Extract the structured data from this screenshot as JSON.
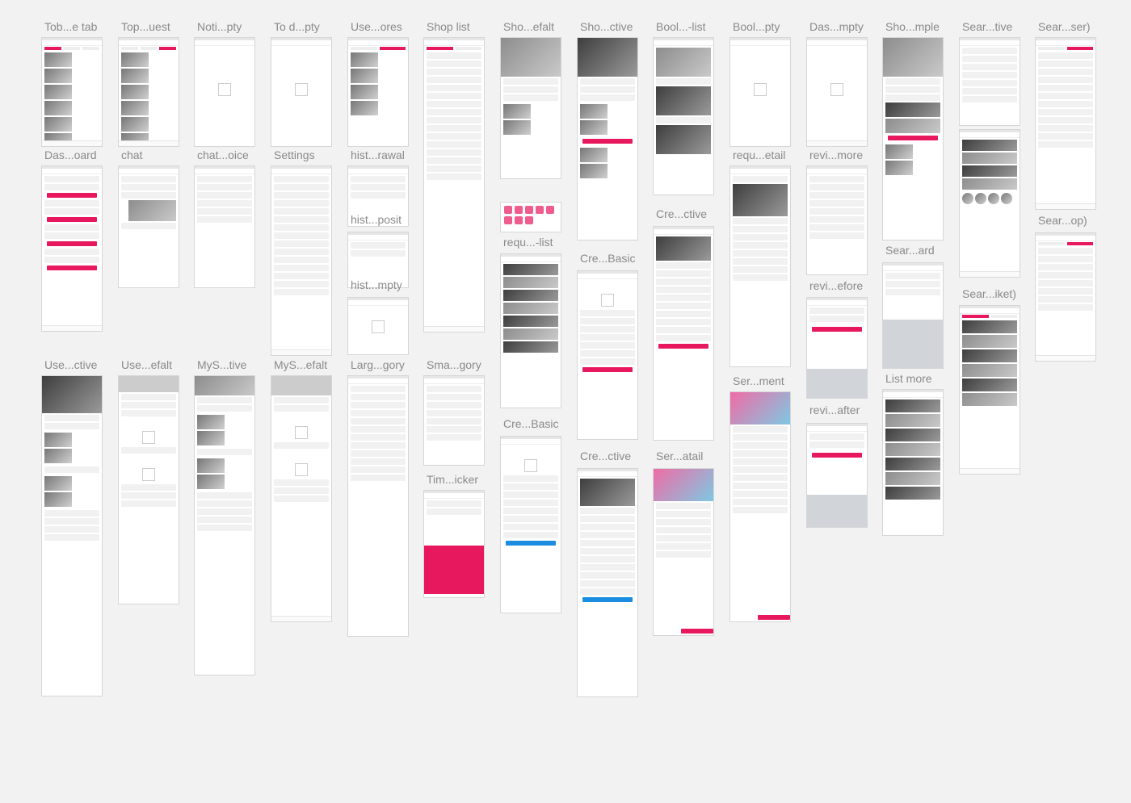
{
  "colors": {
    "background": "#f2f2f2",
    "accent": "#e8185e",
    "blue": "#1a8de0",
    "label": "#8a8a8a"
  },
  "boards": {
    "c1": [
      "Tob...e tab",
      "Das...oard",
      "Use...ctive"
    ],
    "c2": [
      "Top...uest",
      "chat",
      "Use...efalt"
    ],
    "c3": [
      "Noti...pty",
      "chat...oice",
      "MyS...tive"
    ],
    "c4": [
      "To d...pty",
      "Settings",
      "MyS...efalt"
    ],
    "c5": [
      "Use...ores",
      "hist...rawal",
      "hist...posit",
      "hist...mpty",
      "Larg...gory"
    ],
    "c6": [
      "Shop list",
      "Sma...gory",
      "Tim...icker"
    ],
    "c7": [
      "Sho...efalt",
      "requ...-list",
      "Cre...Basic"
    ],
    "c8": [
      "Sho...ctive",
      "Cre...Basic",
      "Cre...ctive"
    ],
    "c9": [
      "Bool...-list",
      "Cre...ctive",
      "Ser...atail"
    ],
    "c10": [
      "Bool...pty",
      "requ...etail",
      "Ser...ment"
    ],
    "c11": [
      "Das...mpty",
      "revi...more",
      "revi...efore",
      "revi...after"
    ],
    "c12": [
      "Sho...mple",
      "Sear...ard",
      "List more"
    ],
    "c13": [
      "Sear...tive",
      "Sear...iket)"
    ],
    "c14": [
      "Sear...ser)",
      "Sear...op)"
    ]
  }
}
